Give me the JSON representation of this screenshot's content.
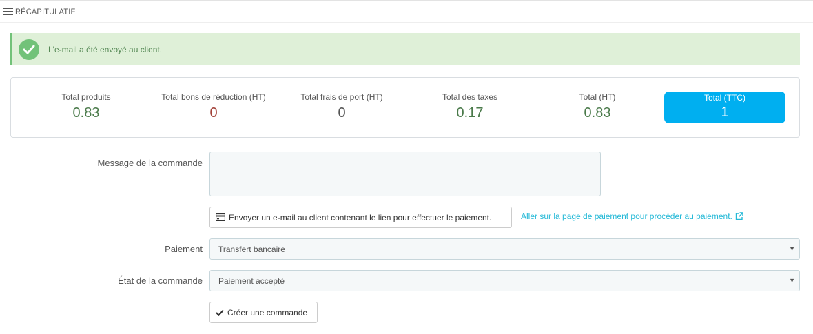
{
  "panel": {
    "title": "RÉCAPITULATIF",
    "icon": "list-icon"
  },
  "alert": {
    "message": "L'e-mail a été envoyé au client.",
    "icon": "check-circle-icon",
    "color": "#72c279"
  },
  "summary": {
    "total_products": {
      "label": "Total produits",
      "value": "0.83"
    },
    "total_discounts": {
      "label": "Total bons de réduction (HT)",
      "value": "0"
    },
    "total_shipping": {
      "label": "Total frais de port (HT)",
      "value": "0"
    },
    "total_taxes": {
      "label": "Total des taxes",
      "value": "0.17"
    },
    "total_ht": {
      "label": "Total (HT)",
      "value": "0.83"
    },
    "total_ttc": {
      "label": "Total (TTC)",
      "value": "1",
      "color": "#00aff0"
    }
  },
  "form": {
    "message": {
      "label": "Message de la commande",
      "value": ""
    },
    "send_email_button": {
      "label": "Envoyer un e-mail au client contenant le lien pour effectuer le paiement.",
      "icon": "credit-card-icon"
    },
    "payment_link": {
      "label": "Aller sur la page de paiement pour procéder au paiement.",
      "icon": "external-link-icon"
    },
    "payment": {
      "label": "Paiement",
      "value": "Transfert bancaire"
    },
    "order_state": {
      "label": "État de la commande",
      "value": "Paiement accepté"
    },
    "create_button": {
      "label": "Créer une commande",
      "icon": "check-icon"
    }
  }
}
